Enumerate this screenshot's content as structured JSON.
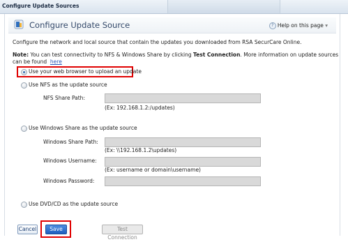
{
  "window": {
    "title": "Configure Update Sources"
  },
  "header": {
    "title": "Configure Update Source",
    "help_label": "Help on this page",
    "help_chevron": "▾"
  },
  "description": "Configure the network and local source that contain the updates you downloaded from RSA SecurCare Online.",
  "note": {
    "prefix": "Note:",
    "text_1": "You can test connectivity to NFS & Windows Share by clicking",
    "bold": "Test Connection",
    "text_2": ". More information on update sources",
    "line2": "can be found",
    "link": "here"
  },
  "options": {
    "browser": "Use your web browser to upload an update",
    "nfs": "Use NFS as the update source",
    "windows": "Use Windows Share as the update source",
    "dvd": "Use DVD/CD as the update source"
  },
  "nfs": {
    "share_path_label": "NFS Share Path:",
    "share_path_value": "",
    "share_path_hint": "(Ex: 192.168.1.2:/updates)"
  },
  "windows": {
    "share_path_label": "Windows Share Path:",
    "share_path_value": "",
    "share_path_hint": "(Ex: \\\\192.168.1.2\\updates)",
    "username_label": "Windows Username:",
    "username_value": "",
    "username_hint": "(Ex: username or domain\\username)",
    "password_label": "Windows Password:",
    "password_value": ""
  },
  "buttons": {
    "cancel": "Cancel",
    "save": "Save",
    "test_connection": "Test Connection"
  },
  "colors": {
    "highlight": "#e00000",
    "primary_button": "#1f5fbf",
    "link": "#2a56b8"
  }
}
